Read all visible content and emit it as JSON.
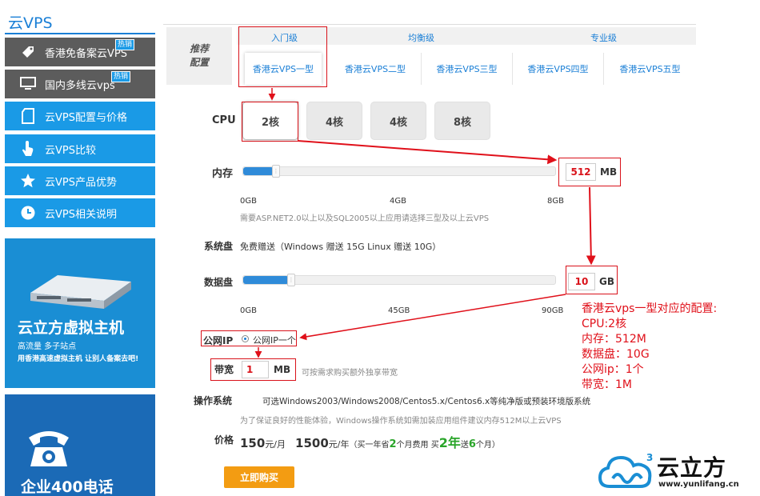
{
  "sidebar": {
    "title": "云VPS",
    "items": [
      {
        "label": "香港免备案云VPS",
        "badge": "热销",
        "icon": "tag-icon",
        "style": "grey"
      },
      {
        "label": "国内多线云vps",
        "badge": "热销",
        "icon": "monitor-icon",
        "style": "grey"
      },
      {
        "label": "云VPS配置与价格",
        "icon": "document-icon",
        "style": "blue"
      },
      {
        "label": "云VPS比较",
        "icon": "pointer-icon",
        "style": "blue"
      },
      {
        "label": "云VPS产品优势",
        "icon": "star-icon",
        "style": "blue"
      },
      {
        "label": "云VPS相关说明",
        "icon": "clock-icon",
        "style": "blue"
      }
    ],
    "banner1": {
      "title": "云立方虚拟主机",
      "subtitle": "高流量 多子站点",
      "tagline": "用香港高速虚拟主机 让别人备案去吧!"
    },
    "banner2": {
      "title": "企业400电话"
    }
  },
  "config": {
    "recommend_label_1": "推荐",
    "recommend_label_2": "配置",
    "levels": [
      "入门级",
      "均衡级",
      "专业级"
    ],
    "models": [
      "香港云VPS一型",
      "香港云VPS二型",
      "香港云VPS三型",
      "香港云VPS四型",
      "香港云VPS五型"
    ],
    "active_model": 0,
    "cpu": {
      "label": "CPU",
      "options": [
        "2核",
        "4核",
        "4核",
        "8核"
      ],
      "selected": 0
    },
    "memory": {
      "label": "内存",
      "value": "512",
      "unit": "MB",
      "fill_fraction": 0.0625,
      "ticks": [
        "0GB",
        "4GB",
        "8GB"
      ],
      "note": "需要ASP.NET2.0以上以及SQL2005以上应用请选择三型及以上云VPS"
    },
    "system_disk": {
      "label": "系统盘",
      "text": "免费赠送（Windows 赠送 15G Linux 赠送 10G）"
    },
    "data_disk": {
      "label": "数据盘",
      "value": "10",
      "unit": "GB",
      "fill_fraction": 0.111,
      "ticks": [
        "0GB",
        "45GB",
        "90GB"
      ]
    },
    "public_ip": {
      "label": "公网IP",
      "option": "公网IP一个"
    },
    "bandwidth": {
      "label": "带宽",
      "value": "1",
      "unit": "MB",
      "note": "可按需求购买额外独享带宽"
    },
    "os": {
      "label": "操作系统",
      "text": "可选Windows2003/Windows2008/Centos5.x/Centos6.x等纯净版或预装环境版系统",
      "note": "为了保证良好的性能体验，Windows操作系统如需加装应用组件建议内存512M以上云VPS"
    },
    "price": {
      "label": "价格",
      "monthly": "150",
      "monthly_unit": "元/月",
      "yearly": "1500",
      "yearly_unit": "元/年",
      "promo_prefix": "（买一年省",
      "promo_save": "2",
      "promo_mid": "个月费用 买",
      "promo_buy": "2年",
      "promo_send": "送",
      "promo_free": "6",
      "promo_suffix": "个月）"
    },
    "buy_label": "立即购买"
  },
  "annotation": {
    "lines": [
      "香港云vps一型对应的配置:",
      "CPU:2核",
      "内存：512M",
      "数据盘：10G",
      "公网ip：1个",
      "带宽：1M"
    ]
  },
  "brand": {
    "name": "云立方",
    "url": "www.yunlifang.cn",
    "superscript": "3"
  },
  "colors": {
    "accent": "#1a9ae6",
    "annotation": "#e0101a",
    "buy": "#f39c12",
    "promo": "#2aa52a"
  }
}
